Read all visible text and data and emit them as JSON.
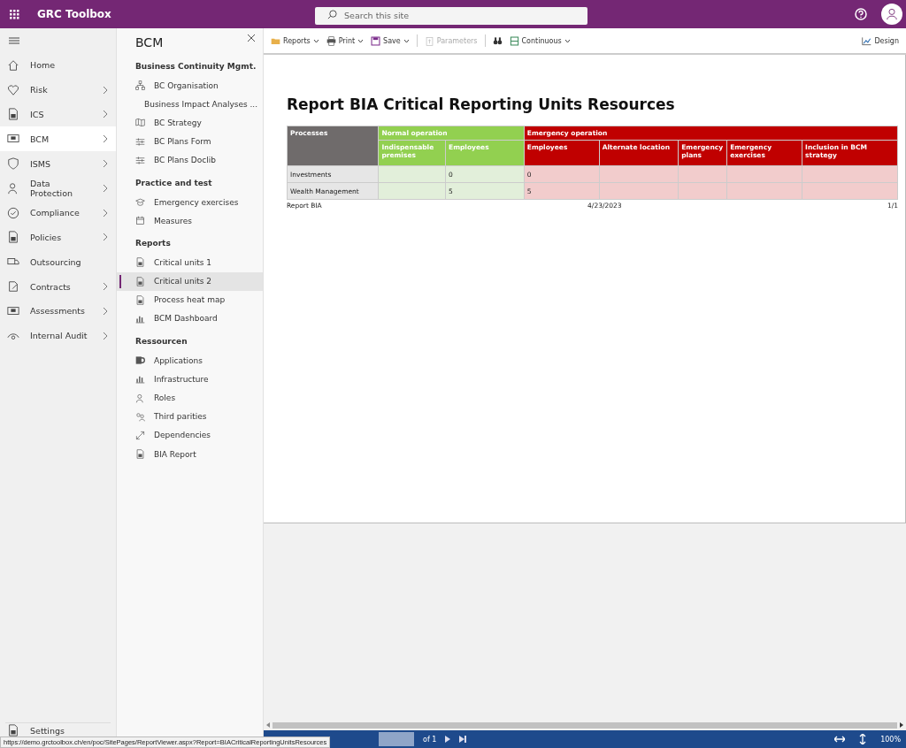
{
  "top_bar": {
    "app_title": "GRC Toolbox",
    "search": {
      "placeholder": "Search this site"
    }
  },
  "nav": {
    "items": [
      {
        "label": "Home",
        "selected": false,
        "has_children": false
      },
      {
        "label": "Risk",
        "selected": false,
        "has_children": true
      },
      {
        "label": "ICS",
        "selected": false,
        "has_children": true
      },
      {
        "label": "BCM",
        "selected": true,
        "has_children": true
      },
      {
        "label": "ISMS",
        "selected": false,
        "has_children": true
      },
      {
        "label": "Data Protection",
        "selected": false,
        "has_children": true
      },
      {
        "label": "Compliance",
        "selected": false,
        "has_children": true
      },
      {
        "label": "Policies",
        "selected": false,
        "has_children": true
      },
      {
        "label": "Outsourcing",
        "selected": false,
        "has_children": false
      },
      {
        "label": "Contracts",
        "selected": false,
        "has_children": true
      },
      {
        "label": "Assessments",
        "selected": false,
        "has_children": true
      },
      {
        "label": "Internal Audit",
        "selected": false,
        "has_children": true
      }
    ],
    "footer_item": {
      "label": "Settings"
    }
  },
  "subnav": {
    "title": "BCM",
    "sections": [
      {
        "heading": "Business Continuity Mgmt.",
        "items": [
          {
            "label": "BC Organisation",
            "selected": false
          },
          {
            "label": "Business Impact Analyses ...",
            "selected": false
          },
          {
            "label": "BC Strategy",
            "selected": false
          },
          {
            "label": "BC Plans Form",
            "selected": false
          },
          {
            "label": "BC Plans Doclib",
            "selected": false
          }
        ]
      },
      {
        "heading": "Practice and test",
        "items": [
          {
            "label": "Emergency exercises",
            "selected": false
          },
          {
            "label": "Measures",
            "selected": false
          }
        ]
      },
      {
        "heading": "Reports",
        "items": [
          {
            "label": "Critical units 1",
            "selected": false
          },
          {
            "label": "Critical units 2",
            "selected": true
          },
          {
            "label": "Process heat map",
            "selected": false
          },
          {
            "label": "BCM Dashboard",
            "selected": false
          }
        ]
      },
      {
        "heading": "Ressourcen",
        "items": [
          {
            "label": "Applications",
            "selected": false
          },
          {
            "label": "Infrastructure",
            "selected": false
          },
          {
            "label": "Roles",
            "selected": false
          },
          {
            "label": "Third parities",
            "selected": false
          },
          {
            "label": "Dependencies",
            "selected": false
          },
          {
            "label": "BIA Report",
            "selected": false
          }
        ]
      }
    ]
  },
  "toolbar": {
    "items": [
      {
        "label": "Reports",
        "dropdown": true,
        "disabled": false
      },
      {
        "label": "Print",
        "dropdown": true,
        "disabled": false
      },
      {
        "label": "Save",
        "dropdown": true,
        "disabled": false
      },
      {
        "label": "Parameters",
        "dropdown": false,
        "disabled": true
      },
      {
        "label": "Continuous",
        "dropdown": true,
        "disabled": false
      }
    ],
    "design": "Design"
  },
  "report": {
    "title": "Report BIA Critical Reporting Units Resources",
    "groups": [
      {
        "label": "Processes",
        "kind": "key"
      },
      {
        "label": "Normal operation",
        "kind": "normal"
      },
      {
        "label": "Emergency operation",
        "kind": "emergency"
      }
    ],
    "columns": [
      {
        "label": "Indispensable premises",
        "kind": "normal"
      },
      {
        "label": "Employees",
        "kind": "normal"
      },
      {
        "label": "Employees",
        "kind": "emergency"
      },
      {
        "label": "Alternate location",
        "kind": "emergency"
      },
      {
        "label": "Emergency plans",
        "kind": "emergency"
      },
      {
        "label": "Emergency exercises",
        "kind": "emergency"
      },
      {
        "label": "Inclusion in BCM strategy",
        "kind": "emergency"
      }
    ],
    "rows": [
      {
        "process": "Investments",
        "cells": [
          "",
          "0",
          "0",
          "",
          "",
          "",
          ""
        ]
      },
      {
        "process": "Wealth Management",
        "cells": [
          "",
          "5",
          "5",
          "",
          "",
          "",
          ""
        ]
      }
    ],
    "footer": {
      "left": "Report BIA",
      "center": "4/23/2023",
      "right": "1/1"
    }
  },
  "pager": {
    "of_label": "of 1",
    "zoom": "100%"
  },
  "status_url": "https://demo.grctoolbox.ch/en/poc/SitePages/ReportViewer.aspx?Report=BIACriticalReportingUnitsResources"
}
